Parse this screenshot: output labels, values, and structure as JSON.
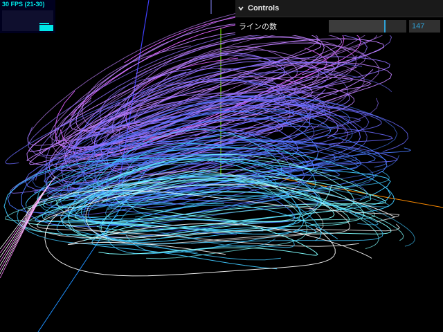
{
  "stats": {
    "label": "30 FPS (21-30)",
    "fps": 30,
    "fps_min": 21,
    "fps_max": 30
  },
  "controls": {
    "title": "Controls",
    "line_count_label": "ラインの数",
    "line_count_value": "147",
    "line_count_fraction": 0.72
  },
  "scene": {
    "background": "#000000",
    "axis_y_color": "#7fff00",
    "axis_x_color": "#ff8c00",
    "axis_z_color": "#1e90ff",
    "line_palette": [
      "#e060ff",
      "#c080ff",
      "#9070ff",
      "#6a6aff",
      "#4a7aff",
      "#40c8ff",
      "#80ffff",
      "#ffffff"
    ]
  }
}
